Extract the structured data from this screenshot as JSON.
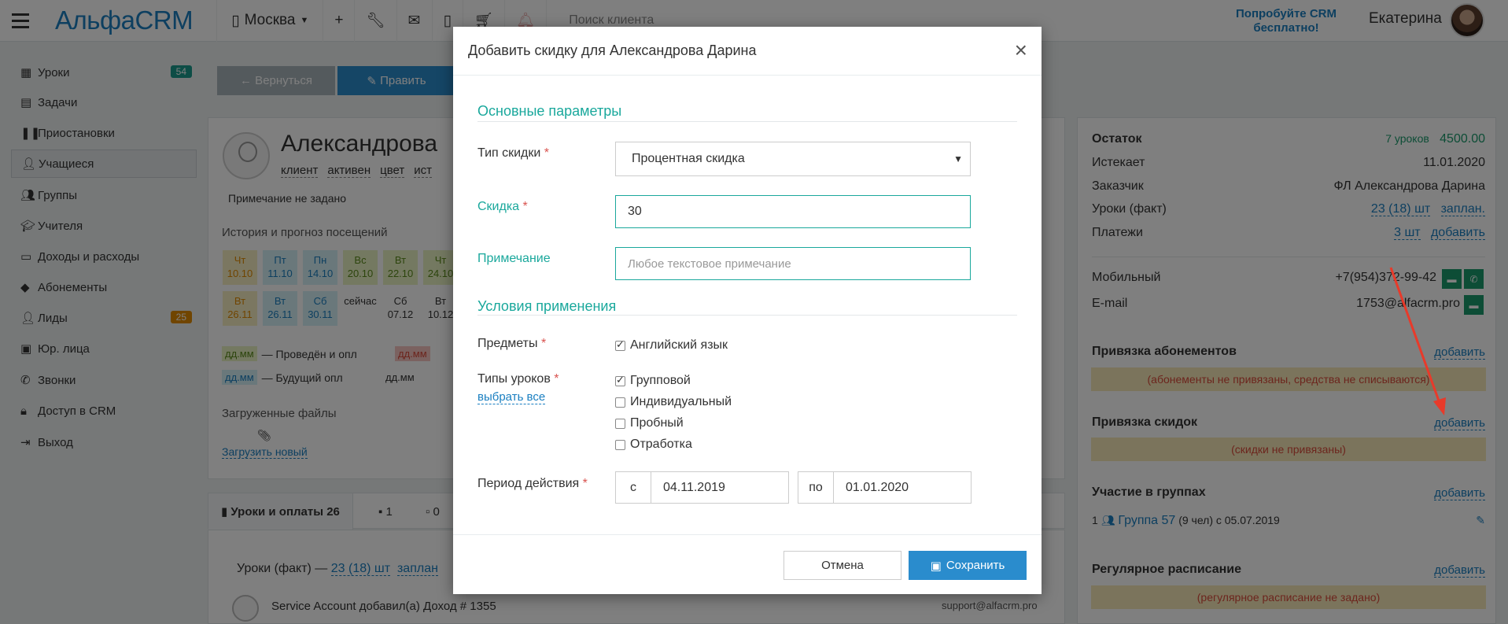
{
  "topbar": {
    "logo": "АльфаCRM",
    "city": "Москва",
    "search_placeholder": "Поиск клиента",
    "promo": "Попробуйте CRM бесплатно!",
    "user": "Екатерина"
  },
  "sidebar": {
    "items": [
      {
        "label": "Уроки",
        "badge": "54"
      },
      {
        "label": "Задачи"
      },
      {
        "label": "Приостановки"
      },
      {
        "label": "Учащиеся"
      },
      {
        "label": "Группы"
      },
      {
        "label": "Учителя"
      },
      {
        "label": "Доходы и расходы"
      },
      {
        "label": "Абонементы"
      },
      {
        "label": "Лиды",
        "badge": "25"
      },
      {
        "label": "Юр. лица"
      },
      {
        "label": "Звонки"
      },
      {
        "label": "Доступ в CRM"
      },
      {
        "label": "Выход"
      }
    ]
  },
  "toolbar": {
    "back": "← Вернуться",
    "edit": "Править"
  },
  "client": {
    "name": "Александрова",
    "tags": [
      "клиент",
      "активен",
      "цвет",
      "ист"
    ],
    "note": "Примечание не задано",
    "history_title": "История и прогноз посещений",
    "history_row1": [
      {
        "d": "Чт",
        "n": "10.10",
        "c": "c-or"
      },
      {
        "d": "Пт",
        "n": "11.10",
        "c": "c-bl"
      },
      {
        "d": "Пн",
        "n": "14.10",
        "c": "c-bl"
      },
      {
        "d": "Вс",
        "n": "20.10",
        "c": "c-gr"
      },
      {
        "d": "Вт",
        "n": "22.10",
        "c": "c-gr"
      },
      {
        "d": "Чт",
        "n": "24.10",
        "c": "c-gr"
      }
    ],
    "history_row2": [
      {
        "d": "Вт",
        "n": "26.11",
        "c": "c-or"
      },
      {
        "d": "Вт",
        "n": "26.11",
        "c": "c-bl"
      },
      {
        "d": "Сб",
        "n": "30.11",
        "c": "c-bl"
      },
      {
        "d": "",
        "n": "сейчас",
        "c": "c-wh"
      },
      {
        "d": "Сб",
        "n": "07.12",
        "c": "c-wh"
      },
      {
        "d": "Вт",
        "n": "10.12",
        "c": "c-wh"
      }
    ],
    "legend1": "— Проведён и опл",
    "legend2": "— Будущий опл",
    "legend_sw": "дд.мм",
    "files_title": "Загруженные файлы",
    "upload": "Загрузить новый"
  },
  "tabs": [
    {
      "label": "Уроки и оплаты 26"
    },
    {
      "label": "1"
    },
    {
      "label": "0"
    }
  ],
  "lessons": {
    "subtitle": "Уроки (факт) —",
    "count": "23 (18) шт",
    "planned": "заплан",
    "account": "Service Account",
    "account_action": "добавил(а) Доход # 1355",
    "account_mail": "support@alfacrm.pro"
  },
  "right": {
    "balance_label": "Остаток",
    "balance_lessons": "7 уроков",
    "balance_sum": "4500.00",
    "expires_label": "Истекает",
    "expires": "11.01.2020",
    "customer_label": "Заказчик",
    "customer": "ФЛ Александрова Дарина",
    "lessons_label": "Уроки (факт)",
    "lessons_val": "23 (18) шт",
    "lessons_planned": "заплан.",
    "payments_label": "Платежи",
    "payments_val": "3 шт",
    "add": "добавить",
    "mobile_label": "Мобильный",
    "mobile": "+7(954)372-99-42",
    "email_label": "E-mail",
    "email": "1753@alfacrm.pro",
    "sub_title": "Привязка абонементов",
    "sub_warn": "(абонементы не привязаны, средства не списываются)",
    "disc_title": "Привязка скидок",
    "disc_warn": "(скидки не привязаны)",
    "groups_title": "Участие в группах",
    "group_num": "1",
    "group_name": "Группа 57",
    "group_meta": "(9 чел)  с 05.07.2019",
    "sched_title": "Регулярное расписание",
    "sched_warn": "(регулярное расписание не задано)"
  },
  "modal": {
    "title": "Добавить скидку для Александрова Дарина",
    "close": "×",
    "section_main": "Основные параметры",
    "type_label": "Тип скидки",
    "type_value": "Процентная скидка",
    "discount_label": "Скидка",
    "discount_value": "30",
    "note_label": "Примечание",
    "note_placeholder": "Любое текстовое примечание",
    "section_cond": "Условия применения",
    "subjects_label": "Предметы",
    "subjects": [
      {
        "label": "Английский язык",
        "checked": true
      }
    ],
    "lesson_types_label": "Типы уроков",
    "select_all": "выбрать все",
    "lesson_types": [
      {
        "label": "Групповой",
        "checked": true
      },
      {
        "label": "Индивидуальный",
        "checked": false
      },
      {
        "label": "Пробный",
        "checked": false
      },
      {
        "label": "Отработка",
        "checked": false
      }
    ],
    "period_label": "Период действия",
    "from_label": "с",
    "from_value": "04.11.2019",
    "to_label": "по",
    "to_value": "01.01.2020",
    "cancel": "Отмена",
    "save": "Сохранить",
    "required_mark": "*"
  },
  "colors": {
    "accent": "#1aa89c",
    "primary": "#2a8ccd",
    "danger": "#d94a3a",
    "arrow": "#e83a2a"
  }
}
